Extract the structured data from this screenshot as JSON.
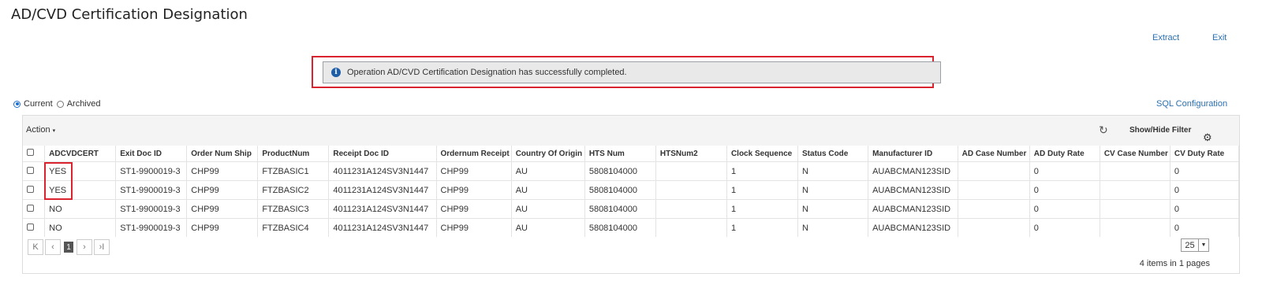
{
  "page": {
    "title": "AD/CVD Certification Designation"
  },
  "links": {
    "extract": "Extract",
    "exit": "Exit",
    "sql_config": "SQL Configuration"
  },
  "notice": {
    "message": "Operation AD/CVD Certification Designation has successfully completed.",
    "icon": "info-icon"
  },
  "view": {
    "current": "Current",
    "archived": "Archived",
    "selected": "Current"
  },
  "toolbar": {
    "action": "Action",
    "show_hide": "Show/Hide Filter"
  },
  "columns": [
    "ADCVDCERT",
    "Exit Doc ID",
    "Order Num Ship",
    "ProductNum",
    "Receipt Doc ID",
    "Ordernum Receipt",
    "Country Of Origin",
    "HTS Num",
    "HTSNum2",
    "Clock Sequence",
    "Status Code",
    "Manufacturer ID",
    "AD Case Number",
    "AD Duty Rate",
    "CV Case Number",
    "CV Duty Rate"
  ],
  "rows": [
    [
      "YES",
      "ST1-9900019-3",
      "CHP99",
      "FTZBASIC1",
      "4011231A124SV3N1447",
      "CHP99",
      "AU",
      "5808104000",
      "",
      "1",
      "N",
      "AUABCMAN123SID",
      "",
      "0",
      "",
      "0"
    ],
    [
      "YES",
      "ST1-9900019-3",
      "CHP99",
      "FTZBASIC2",
      "4011231A124SV3N1447",
      "CHP99",
      "AU",
      "5808104000",
      "",
      "1",
      "N",
      "AUABCMAN123SID",
      "",
      "0",
      "",
      "0"
    ],
    [
      "NO",
      "ST1-9900019-3",
      "CHP99",
      "FTZBASIC3",
      "4011231A124SV3N1447",
      "CHP99",
      "AU",
      "5808104000",
      "",
      "1",
      "N",
      "AUABCMAN123SID",
      "",
      "0",
      "",
      "0"
    ],
    [
      "NO",
      "ST1-9900019-3",
      "CHP99",
      "FTZBASIC4",
      "4011231A124SV3N1447",
      "CHP99",
      "AU",
      "5808104000",
      "",
      "1",
      "N",
      "AUABCMAN123SID",
      "",
      "0",
      "",
      "0"
    ]
  ],
  "pager": {
    "first": "K",
    "prev": "‹",
    "page": "1",
    "next": "›",
    "last": "›I",
    "page_size": "25",
    "summary": "4 items in 1 pages"
  },
  "colors": {
    "link": "#2a6fb0",
    "highlight": "#d9232e"
  }
}
